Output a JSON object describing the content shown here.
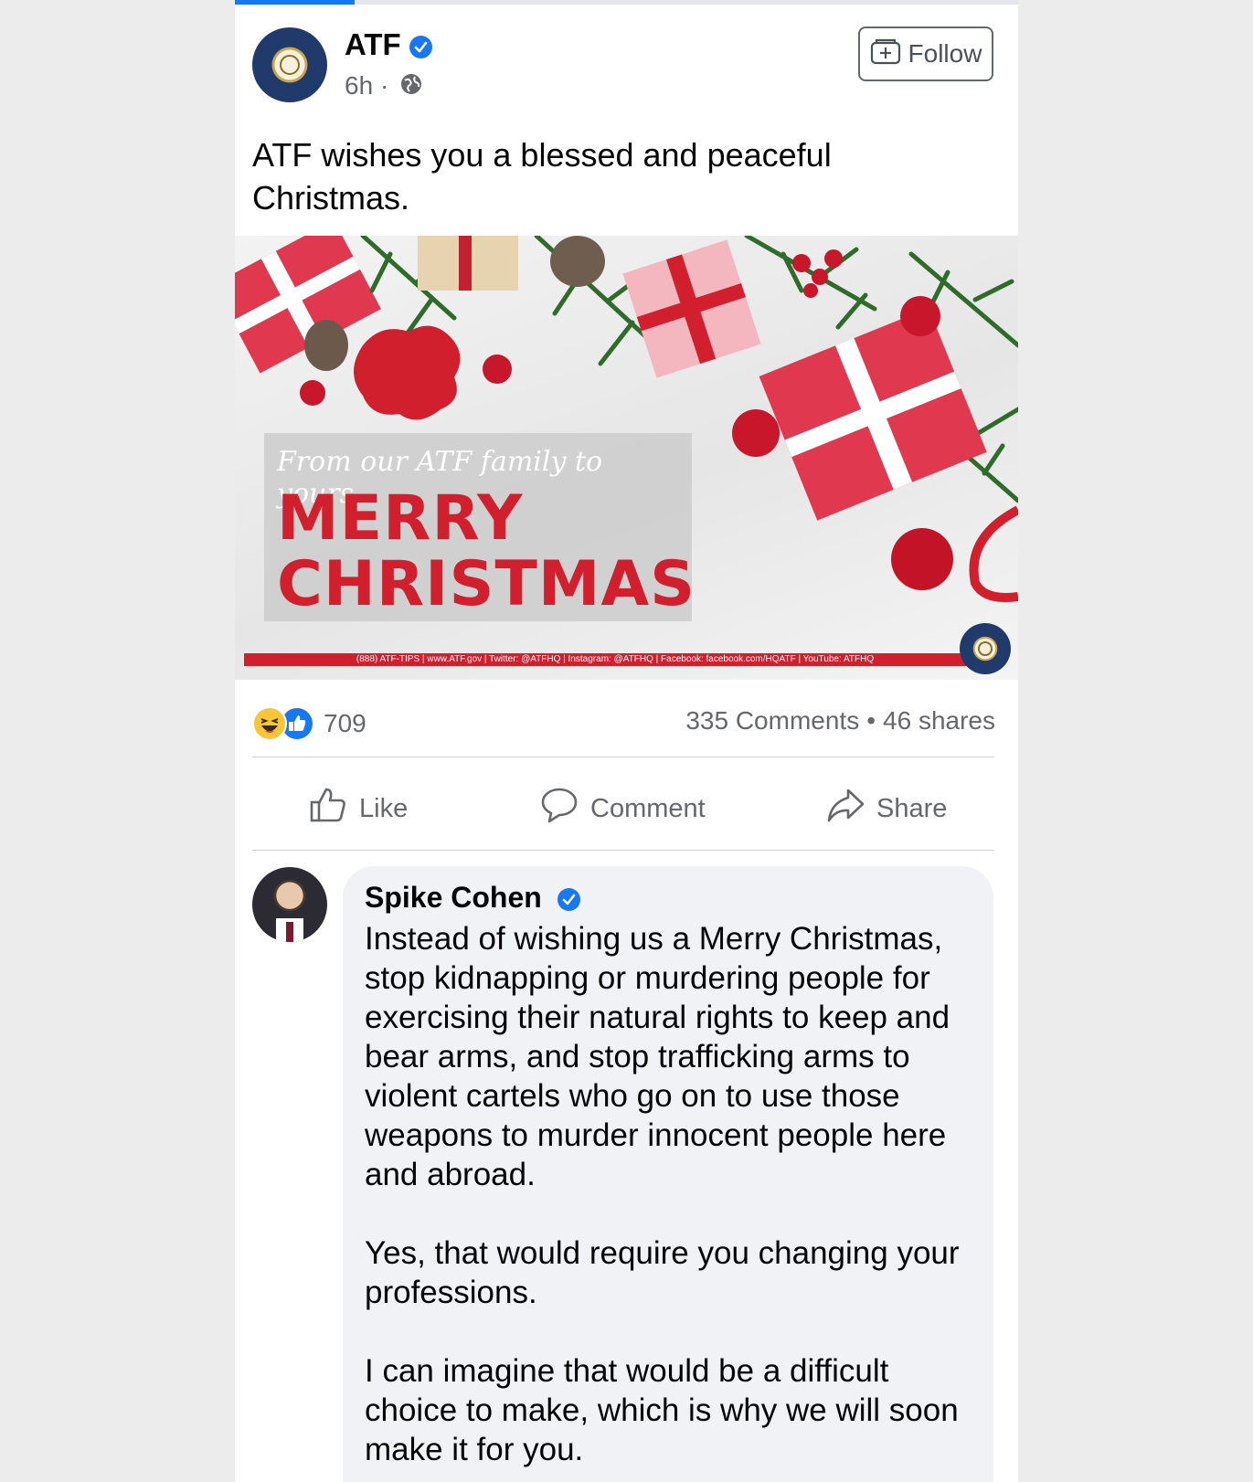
{
  "post": {
    "author": "ATF",
    "time": "6h",
    "separator": "·",
    "follow_label": "Follow",
    "text": "ATF wishes you a blessed and peaceful Christmas."
  },
  "image": {
    "script_text": "From our ATF family to yours,",
    "line1": "MERRY",
    "line2": "CHRISTMAS",
    "banner": "(888) ATF-TIPS | www.ATF.gov | Twitter: @ATFHQ | Instagram: @ATFHQ | Facebook: facebook.com/HQATF | YouTube: ATFHQ"
  },
  "stats": {
    "reaction_count": "709",
    "comments": "335 Comments",
    "dot": "•",
    "shares": "46 shares"
  },
  "actions": {
    "like": "Like",
    "comment": "Comment",
    "share": "Share"
  },
  "comment": {
    "author": "Spike Cohen",
    "paragraphs": [
      "Instead of wishing us a Merry Christmas, stop kidnapping or murdering people for exercising their natural rights to keep and bear arms, and stop trafficking arms to violent cartels who go on to use those weapons to murder innocent people here and abroad.",
      "Yes, that would require you changing your professions.",
      "I can imagine that would be a difficult choice to make, which is why we will soon make it for you."
    ]
  },
  "colors": {
    "accent": "#1877f2",
    "christmas_red": "#d11f2e",
    "muted_text": "#65676b"
  },
  "icons": [
    "verified-badge-icon",
    "globe-icon",
    "follow-icon",
    "haha-reaction-icon",
    "like-reaction-icon",
    "like-icon",
    "comment-icon",
    "share-icon"
  ]
}
